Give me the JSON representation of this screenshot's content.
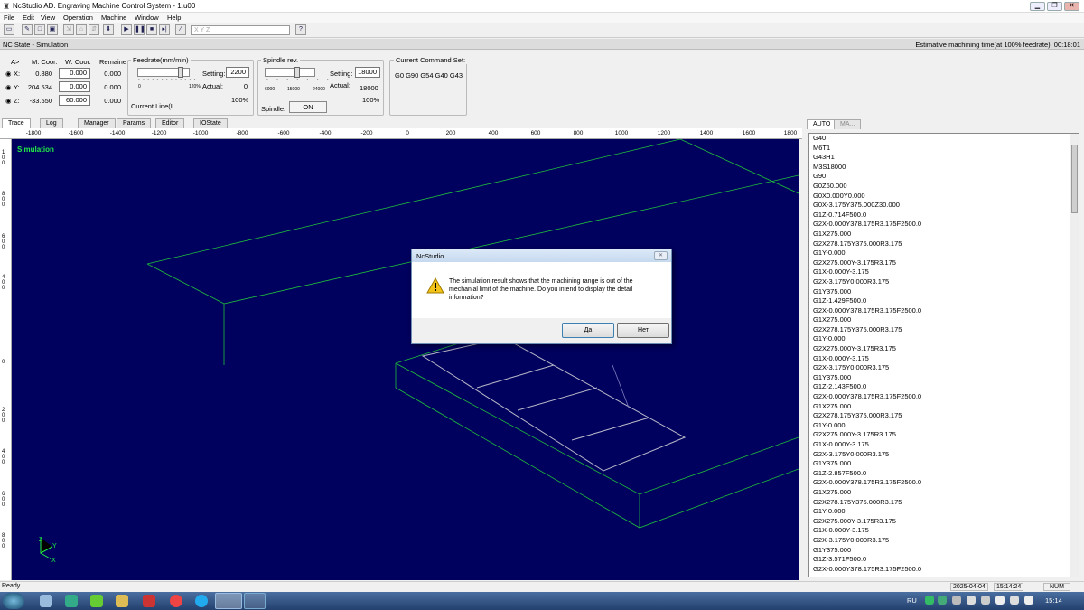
{
  "window": {
    "title": "NcStudio AD. Engraving Machine Control System  - 1.u00"
  },
  "menu": [
    "File",
    "Edit",
    "View",
    "Operation",
    "Machine",
    "Window",
    "Help"
  ],
  "toolbar": {
    "axis_field": "X    Y    Z"
  },
  "state": {
    "left": "NC State - Simulation",
    "right": "Estimative machining time(at 100% feedrate): 00:18:01"
  },
  "coords": {
    "header": {
      "sel": "A>",
      "m": "M. Coor.",
      "w": "W. Coor.",
      "r": "Remaine"
    },
    "rows": [
      {
        "axis": "X:",
        "m": "0.880",
        "w": "0.000",
        "r": "0.000"
      },
      {
        "axis": "Y:",
        "m": "204.534",
        "w": "0.000",
        "r": "0.000"
      },
      {
        "axis": "Z:",
        "m": "-33.550",
        "w": "60.000",
        "r": "0.000"
      }
    ]
  },
  "feed": {
    "title": "Feedrate(mm/min)",
    "min": "0",
    "max": "120%",
    "setting_label": "Setting:",
    "setting": "2200",
    "actual_label": "Actual:",
    "actual": "0",
    "percent": "100%",
    "current_line": "Current Line(I"
  },
  "spindle": {
    "title": "Spindle rev.",
    "t1": "6000",
    "t2": "15000",
    "t3": "24000",
    "setting_label": "Setting:",
    "setting": "18000",
    "actual_label": "Actual:",
    "actual": "18000",
    "percent": "100%",
    "label": "Spindle:",
    "state": "ON"
  },
  "command": {
    "title": "Current Command Set:",
    "value": "G0 G90 G54 G40 G43"
  },
  "tabs": [
    "Trace",
    "Log",
    "Manager",
    "Params",
    "Editor",
    "IOState"
  ],
  "ruler": [
    "-1800",
    "-1600",
    "-1400",
    "-1200",
    "-1000",
    "-800",
    "-600",
    "-400",
    "-200",
    "0",
    "200",
    "400",
    "600",
    "800",
    "1000",
    "1200",
    "1400",
    "1600",
    "1800"
  ],
  "vruler": [
    "100",
    "800",
    "600",
    "400",
    "0",
    "200",
    "400",
    "600",
    "800"
  ],
  "canvas": {
    "label": "Simulation",
    "axis_z": "Z",
    "axis_y": "Y",
    "axis_x": "X"
  },
  "right_tabs": [
    "AUTO",
    "MA..."
  ],
  "gcode": [
    "G40",
    "M6T1",
    "G43H1",
    "M3S18000",
    "G90",
    "G0Z60.000",
    "G0X0.000Y0.000",
    "G0X-3.175Y375.000Z30.000",
    "G1Z-0.714F500.0",
    "G2X-0.000Y378.175R3.175F2500.0",
    "G1X275.000",
    "G2X278.175Y375.000R3.175",
    "G1Y-0.000",
    "G2X275.000Y-3.175R3.175",
    "G1X-0.000Y-3.175",
    "G2X-3.175Y0.000R3.175",
    "G1Y375.000",
    "G1Z-1.429F500.0",
    "G2X-0.000Y378.175R3.175F2500.0",
    "G1X275.000",
    "G2X278.175Y375.000R3.175",
    "G1Y-0.000",
    "G2X275.000Y-3.175R3.175",
    "G1X-0.000Y-3.175",
    "G2X-3.175Y0.000R3.175",
    "G1Y375.000",
    "G1Z-2.143F500.0",
    "G2X-0.000Y378.175R3.175F2500.0",
    "G1X275.000",
    "G2X278.175Y375.000R3.175",
    "G1Y-0.000",
    "G2X275.000Y-3.175R3.175",
    "G1X-0.000Y-3.175",
    "G2X-3.175Y0.000R3.175",
    "G1Y375.000",
    "G1Z-2.857F500.0",
    "G2X-0.000Y378.175R3.175F2500.0",
    "G1X275.000",
    "G2X278.175Y375.000R3.175",
    "G1Y-0.000",
    "G2X275.000Y-3.175R3.175",
    "G1X-0.000Y-3.175",
    "G2X-3.175Y0.000R3.175",
    "G1Y375.000",
    "G1Z-3.571F500.0",
    "G2X-0.000Y378.175R3.175F2500.0"
  ],
  "status": {
    "left": "Ready",
    "date": "2025-04-04",
    "time": "15:14:24",
    "num": "NUM"
  },
  "taskbar": {
    "lang": "RU",
    "clock": "15:14"
  },
  "dialog": {
    "title": "NcStudio",
    "message": "The simulation result shows that the machining range is out of the mechanial limit of the machine. Do you intend to display the detail information?",
    "yes": "Да",
    "no": "Нет"
  }
}
